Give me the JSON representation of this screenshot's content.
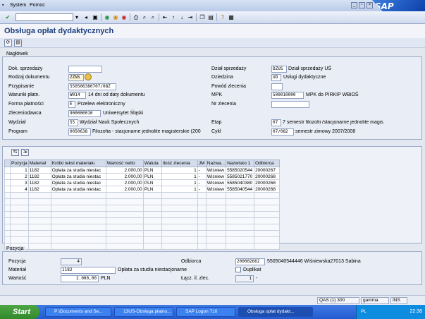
{
  "menu": {
    "system": "System",
    "help": "Pomoc"
  },
  "brand": "SAP",
  "title": "Obsługa opłat dydaktycznych",
  "header": {
    "frame_title": "Nagłówek",
    "left": [
      {
        "label": "Dok. sprzedaży",
        "value": ""
      },
      {
        "label": "Rodzaj dokumentu",
        "value": "ZZNS"
      },
      {
        "label": "Przypisanie",
        "value": "550506380707/08Z"
      },
      {
        "label": "Warunki płatn.",
        "value": "W014",
        "desc": "14 dni od daty dokumentu"
      },
      {
        "label": "Forma płatności",
        "value": "E",
        "desc": "Przelew elektroniczny"
      },
      {
        "label": "Zleceniodawca",
        "value": "900000010",
        "desc": "Uniwersytet Śląski"
      },
      {
        "label": "Wydział",
        "value": "55",
        "desc": "Wydział Nauk Społecznych"
      },
      {
        "label": "Program",
        "value": "0050638",
        "desc": "Filozofia - stacjonarne jednolite magisterskie (200"
      }
    ],
    "right": [
      {
        "label": "Dział sprzedaży",
        "value": "DZUS",
        "desc": "Dział sprzedaży UŚ"
      },
      {
        "label": "Dziedzina",
        "value": "UD",
        "desc": "Usługi dydaktyczne"
      },
      {
        "label": "Powód zlecenia",
        "value": ""
      },
      {
        "label": "MPK",
        "value": "500010000",
        "desc": "MPK do PIRKIP WBiOŚ"
      },
      {
        "label": "Nr zlecenia",
        "value": ""
      },
      {
        "label": "Etap",
        "value": "07",
        "desc": "7 semestr filozofii /stacjonarne jednolite magis"
      },
      {
        "label": "Cykl",
        "value": "07/082",
        "desc": "semestr zimowy 2007/2008"
      }
    ]
  },
  "table": {
    "columns": [
      "Pozycja",
      "Materiał",
      "Krótki tekst materiału",
      "Wartość netto",
      "Waluta",
      "Ilość zlecenia",
      "JM",
      "Nazwa...",
      "Nazwisko 1",
      "Odbiorca"
    ],
    "rows": [
      [
        "1",
        "1182",
        "Opłata za studia niestac",
        "2.000,00",
        "PLN",
        "1",
        "-",
        "Wiśniew",
        "5585020544",
        "20000267"
      ],
      [
        "2",
        "1182",
        "Opłata za studia niestac",
        "2.000,00",
        "PLN",
        "1",
        "-",
        "Wiśniew",
        "5585021770",
        "20000268"
      ],
      [
        "3",
        "1182",
        "Opłata za studia niestac",
        "2.000,00",
        "PLN",
        "1",
        "-",
        "Wiśniew",
        "5585040380",
        "20000268"
      ],
      [
        "4",
        "1182",
        "Opłata za studia niestac",
        "2.000,00",
        "PLN",
        "1",
        "-",
        "Wiśniew",
        "5585040544",
        "20000268"
      ]
    ]
  },
  "position": {
    "frame_title": "Pozycja",
    "pozycja_label": "Pozycja",
    "pozycja": "4",
    "material_label": "Materiał",
    "material": "1182",
    "material_desc": "Opłata za studia niestacjonarne",
    "wartosc_label": "Wartość",
    "wartosc": "2.000,00",
    "waluta": "PLN",
    "odbiorca_label": "Odbiorca",
    "odbiorca": "200002662",
    "odbiorca_desc": "5505040544446 Wiśniewska27013 Sabina",
    "duplikat_label": "Duplikat",
    "lacz_label": "Łącz. il. zlec.",
    "lacz": "1",
    "lacz_unit": "-"
  },
  "status": {
    "system": "QAS (1) 300",
    "server": "gamma",
    "mode": "INS"
  },
  "taskbar": {
    "start": "Start",
    "tasks": [
      "P:\\Documents and Se...",
      "13US-Obsługa płatno...",
      "SAP Logon 710",
      "Obsługa opłat dydakt..."
    ],
    "lang": "PL",
    "clock": "22:38"
  }
}
